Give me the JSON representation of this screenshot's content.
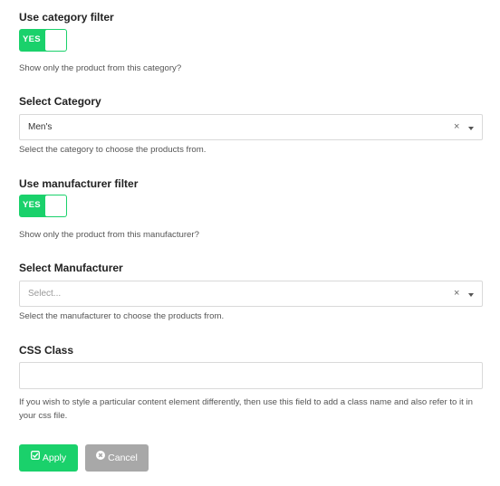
{
  "category_filter": {
    "label": "Use category filter",
    "toggle_text": "YES",
    "help": "Show only the product from this category?"
  },
  "select_category": {
    "label": "Select Category",
    "value": "Men's",
    "clear_symbol": "×",
    "help": "Select the category to choose the products from."
  },
  "manufacturer_filter": {
    "label": "Use manufacturer filter",
    "toggle_text": "YES",
    "help": "Show only the product from this manufacturer?"
  },
  "select_manufacturer": {
    "label": "Select Manufacturer",
    "placeholder": "Select...",
    "clear_symbol": "×",
    "help": "Select the manufacturer to choose the products from."
  },
  "css_class": {
    "label": "CSS Class",
    "value": "",
    "help": "If you wish to style a particular content element differently, then use this field to add a class name and also refer to it in your css file."
  },
  "buttons": {
    "apply_label": "Apply",
    "apply_icon": "check-square-icon",
    "cancel_label": "Cancel",
    "cancel_icon": "times-circle-icon"
  },
  "colors": {
    "accent": "#1ad16b",
    "cancel": "#a8a8a8"
  }
}
